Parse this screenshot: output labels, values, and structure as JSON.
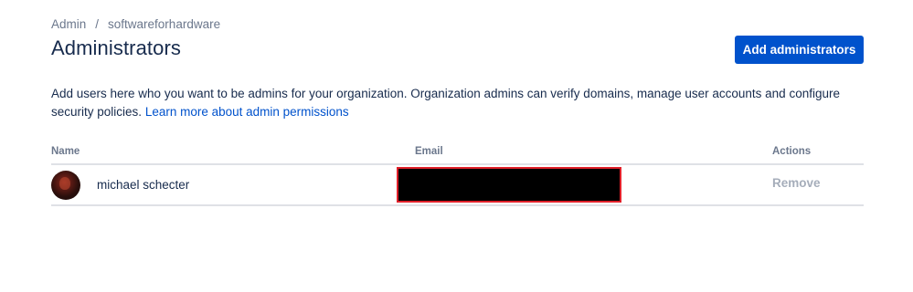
{
  "breadcrumb": {
    "items": [
      "Admin",
      "softwareforhardware"
    ],
    "separator": "/"
  },
  "header": {
    "title": "Administrators",
    "add_button_label": "Add administrators"
  },
  "description": {
    "text": "Add users here who you want to be admins for your organization. Organization admins can verify domains, manage user accounts and configure security policies.",
    "link_label": "Learn more about admin permissions"
  },
  "table": {
    "columns": [
      "Name",
      "Email",
      "Actions"
    ],
    "rows": [
      {
        "name": "michael schecter",
        "email": "",
        "action_label": "Remove"
      }
    ]
  },
  "colors": {
    "primary": "#0052cc",
    "text": "#172b4d",
    "muted": "#6b778c",
    "disabled": "#a5adba",
    "divider": "#dfe1e6",
    "redaction": "#000000",
    "redaction_border": "#e0202a"
  }
}
